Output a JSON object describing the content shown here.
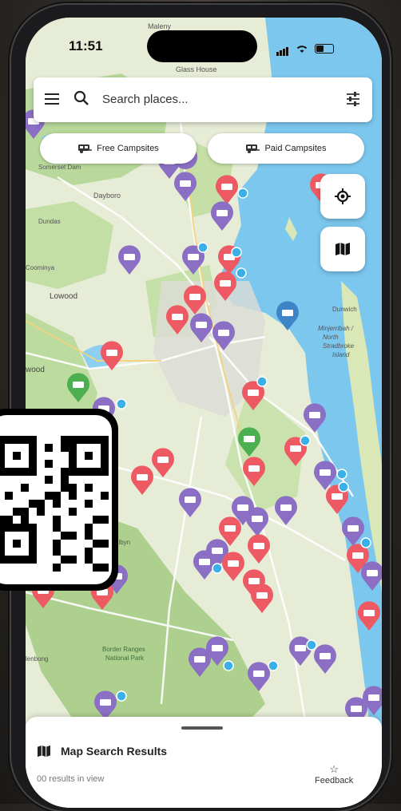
{
  "status_bar": {
    "time": "11:51"
  },
  "search": {
    "placeholder": "Search places..."
  },
  "chips": {
    "free": "Free Campsites",
    "paid": "Paid Campsites"
  },
  "map_labels": {
    "maleny": "Maleny",
    "glass_house": "Glass House Mountains",
    "somerset_dam": "Somerset Dam",
    "dayboro": "Dayboro",
    "dundas": "Dundas",
    "coominya": "Coominya",
    "lowood": "Lowood",
    "wood": "wood",
    "dunwich": "Dunwich",
    "minjerribah": "Minjerribah / North Stradbroke Island",
    "border_ranges": "Border Ranges National Park",
    "lenbong": "lenbong",
    "albyn": "albyn"
  },
  "bottom_sheet": {
    "title": "Map Search Results",
    "count": "00 results in view",
    "feedback": "Feedback"
  },
  "colors": {
    "purple": "#8b6fc4",
    "red": "#ee5a64",
    "green": "#4caf50",
    "blue": "#3d85c6",
    "water": "#6cc3ec"
  }
}
